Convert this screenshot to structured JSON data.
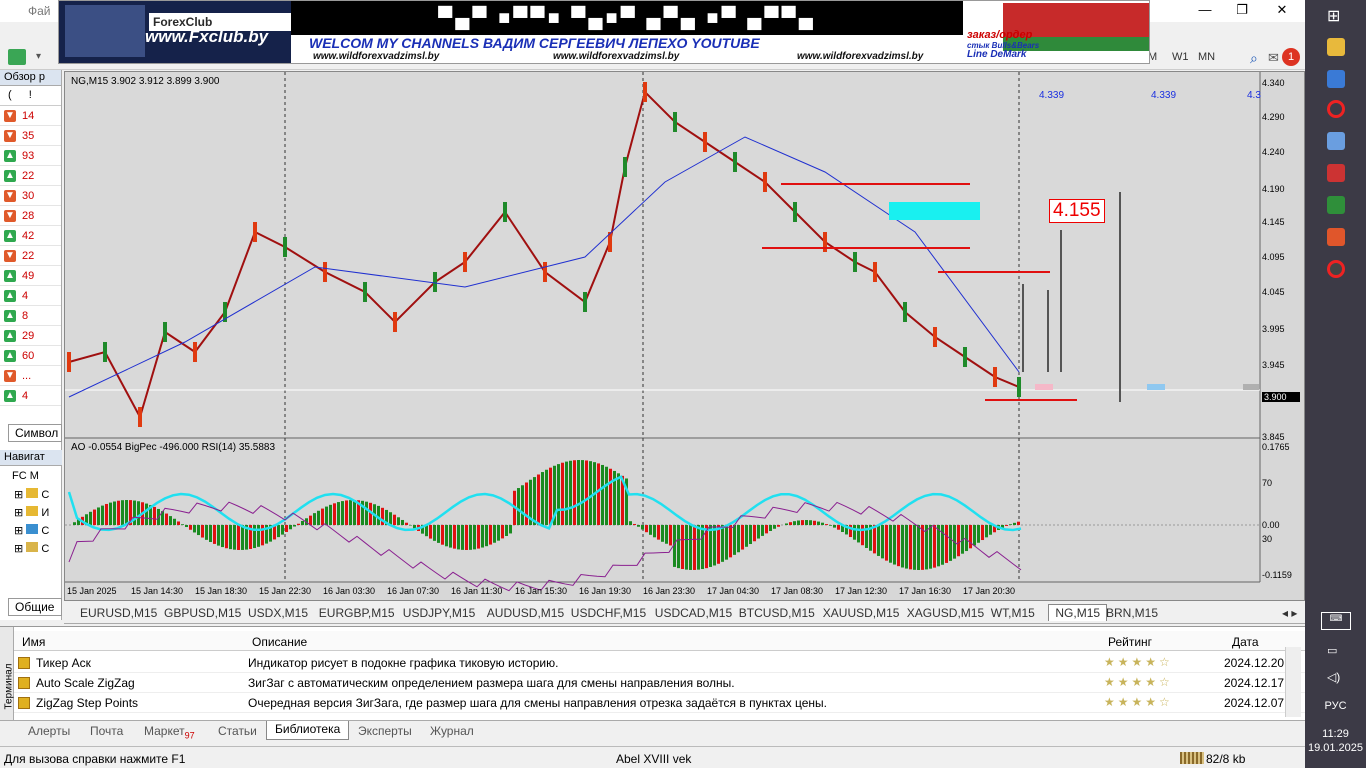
{
  "window": {
    "menu_first": "Фай",
    "buttons": [
      "—",
      "❐",
      "✕"
    ]
  },
  "toolbar": {
    "timeframes": [
      "W1",
      "MN"
    ],
    "notify_count": "1"
  },
  "banner": {
    "logo": "ForexClub",
    "site": "www.Fxclub.by",
    "welcome": "WELCOM MY CHANNELS ВАДИМ СЕРГЕЕВИЧ ЛЕПЕХО YOUTUBE",
    "url1": "www.wildforexvadzimsl.by",
    "url2": "www.wildforexvadzimsl.by",
    "url3": "www.wildforexvadzimsl.by",
    "right1": "заказ/ордер",
    "right2": "стык Bulls&Bears",
    "right3": "Line DeMark"
  },
  "market_watch": {
    "header": "Обзор р",
    "col_headers": [
      "(",
      "!"
    ],
    "rows": [
      {
        "dir": "dn",
        "val": "14"
      },
      {
        "dir": "dn",
        "val": "35"
      },
      {
        "dir": "up",
        "val": "93"
      },
      {
        "dir": "up",
        "val": "22"
      },
      {
        "dir": "dn",
        "val": "30"
      },
      {
        "dir": "dn",
        "val": "28"
      },
      {
        "dir": "up",
        "val": "42"
      },
      {
        "dir": "dn",
        "val": "22"
      },
      {
        "dir": "up",
        "val": "49"
      },
      {
        "dir": "up",
        "val": "4"
      },
      {
        "dir": "up",
        "val": "8"
      },
      {
        "dir": "up",
        "val": "29"
      },
      {
        "dir": "up",
        "val": "60"
      },
      {
        "dir": "dn",
        "val": "..."
      },
      {
        "dir": "up",
        "val": "4"
      }
    ],
    "tab": "Символ"
  },
  "navigator": {
    "header": "Навигат",
    "items": [
      "FC M",
      "С",
      "И",
      "С",
      "С"
    ],
    "tab": "Общие"
  },
  "chart": {
    "header": "NG,M15  3.902 3.912 3.899 3.900",
    "ind_header": "AO -0.0554  BigPec -496.000  RSI(14) 35.5883",
    "price_labels": [
      "4.340",
      "4.290",
      "4.240",
      "4.190",
      "4.145",
      "4.095",
      "4.045",
      "3.995",
      "3.945",
      "3.900",
      "3.845"
    ],
    "current_price": "3.900",
    "ind_labels": [
      "0.1765",
      "70",
      "0.00",
      "30",
      "-0.1159"
    ],
    "target": "4.155",
    "level_labels": [
      "4.339",
      "4.339",
      "4.3"
    ],
    "time_labels": [
      "15 Jan 2025",
      "15 Jan 14:30",
      "15 Jan 18:30",
      "15 Jan 22:30",
      "16 Jan 03:30",
      "16 Jan 07:30",
      "16 Jan 11:30",
      "16 Jan 15:30",
      "16 Jan 19:30",
      "16 Jan 23:30",
      "17 Jan 04:30",
      "17 Jan 08:30",
      "17 Jan 12:30",
      "17 Jan 16:30",
      "17 Jan 20:30"
    ]
  },
  "chart_tabs": [
    "EURUSD,M15",
    "GBPUSD,M15",
    "USDX,M15",
    "EURGBP,M15",
    "USDJPY,M15",
    "AUDUSD,M15",
    "USDCHF,M15",
    "USDCAD,M15",
    "BTCUSD,M15",
    "XAUUSD,M15",
    "XAGUSD,M15",
    "WT,M15",
    "NG,M15",
    "BRN,M15"
  ],
  "active_chart_tab": "NG,M15",
  "terminal": {
    "side": "Терминал",
    "headers": {
      "name": "Имя",
      "desc": "Описание",
      "rating": "Рейтинг",
      "date": "Дата"
    },
    "rows": [
      {
        "name": "Тикер Аск",
        "desc": "Индикатор рисует в подокне графика тиковую историю.",
        "date": "2024.12.20"
      },
      {
        "name": "Auto Scale ZigZag",
        "desc": "ЗигЗаг с автоматическим определением размера шага для смены направления волны.",
        "date": "2024.12.17"
      },
      {
        "name": "ZigZag Step Points",
        "desc": "Очередная версия ЗигЗага, где размер шага для смены направления отрезка задаётся в пунктах цены.",
        "date": "2024.12.07"
      }
    ],
    "tabs": [
      "Алерты",
      "Почта",
      "Маркет",
      "Статьи",
      "Библиотека",
      "Эксперты",
      "Журнал"
    ],
    "market_badge": "97",
    "active_tab": "Библиотека"
  },
  "status": {
    "help": "Для вызова справки нажмите F1",
    "profile": "Abel XVIII vek",
    "traffic": "82/8 kb"
  },
  "taskbar": {
    "lang": "РУС",
    "time": "11:29",
    "date": "19.01.2025"
  }
}
